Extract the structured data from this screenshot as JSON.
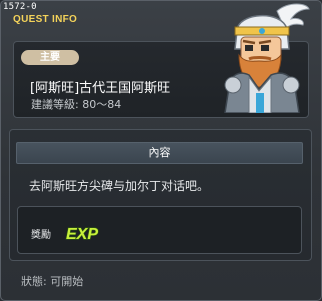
{
  "window": {
    "quest_id": "1572-0",
    "title": "QUEST INFO"
  },
  "quest": {
    "tag": "主要",
    "name": "[阿斯旺]古代王国阿斯旺",
    "level": "建議等級: 80～84"
  },
  "content": {
    "header": "內容",
    "description": "去阿斯旺方尖碑与加尔丁对话吧。"
  },
  "reward": {
    "label": "獎勵",
    "exp_text": "EXP"
  },
  "status": "狀態: 可開始",
  "colors": {
    "title": "#f4d35a",
    "tag_bg": "#cfbfa3",
    "exp_fill": "#c8f03c",
    "exp_outline": "#2e5a10"
  },
  "icons": {
    "portrait": "npc-knight-portrait",
    "exp": "exp-icon"
  }
}
